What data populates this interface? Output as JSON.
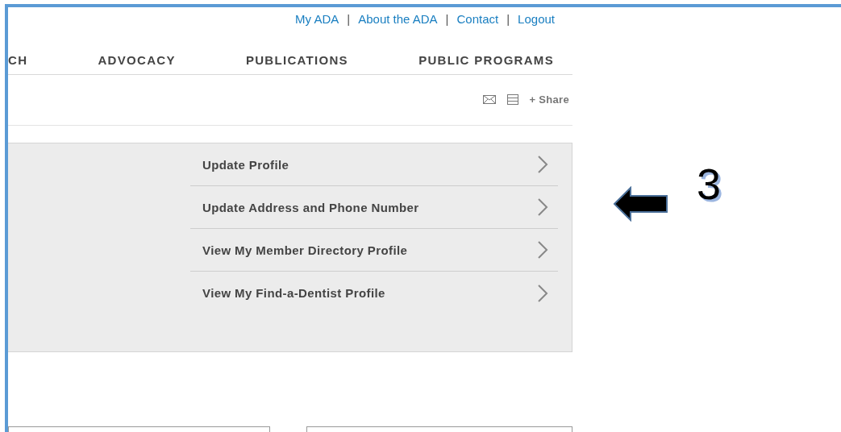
{
  "top_links": [
    {
      "kind": "link",
      "text": "My ADA"
    },
    {
      "kind": "separator",
      "text": "|"
    },
    {
      "kind": "link",
      "text": "About the ADA"
    },
    {
      "kind": "separator",
      "text": "|"
    },
    {
      "kind": "link",
      "text": "Contact"
    },
    {
      "kind": "separator",
      "text": "|"
    },
    {
      "kind": "link",
      "text": "Logout"
    }
  ],
  "nav": [
    "CH",
    "ADVOCACY",
    "PUBLICATIONS",
    "PUBLIC PROGRAMS"
  ],
  "toolbar": {
    "share": "+ Share"
  },
  "menu": [
    {
      "label": "Update Profile"
    },
    {
      "label": "Update Address and Phone Number"
    },
    {
      "label": "View My Member Directory Profile"
    },
    {
      "label": "View My Find-a-Dentist Profile"
    }
  ],
  "annotation": {
    "number": "3"
  }
}
